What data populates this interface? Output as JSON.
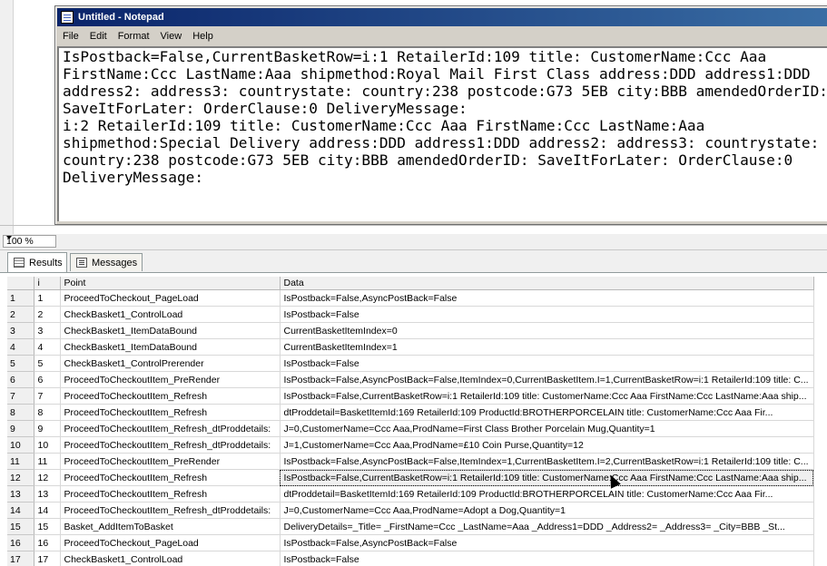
{
  "notepad": {
    "title": "Untitled - Notepad",
    "menu": [
      "File",
      "Edit",
      "Format",
      "View",
      "Help"
    ],
    "text": "IsPostback=False,CurrentBasketRow=i:1 RetailerId:109 title: CustomerName:Ccc Aaa\nFirstName:Ccc LastName:Aaa shipmethod:Royal Mail First Class address:DDD address1:DDD\naddress2: address3: countrystate: country:238 postcode:G73 5EB city:BBB amendedOrderID:\nSaveItForLater: OrderClause:0 DeliveryMessage:\ni:2 RetailerId:109 title: CustomerName:Ccc Aaa FirstName:Ccc LastName:Aaa\nshipmethod:Special Delivery address:DDD address1:DDD address2: address3: countrystate:\ncountry:238 postcode:G73 5EB city:BBB amendedOrderID: SaveItForLater: OrderClause:0\nDeliveryMessage:"
  },
  "zoom": {
    "value": "100 %"
  },
  "tabs": [
    {
      "label": "Results",
      "icon": "grid-icon",
      "active": true
    },
    {
      "label": "Messages",
      "icon": "messages-icon",
      "active": false
    }
  ],
  "grid": {
    "columns": [
      "i",
      "Point",
      "Data"
    ],
    "selected_row": 12,
    "rows": [
      {
        "n": "1",
        "i": "1",
        "point": "ProceedToCheckout_PageLoad",
        "data": "IsPostback=False,AsyncPostBack=False"
      },
      {
        "n": "2",
        "i": "2",
        "point": "CheckBasket1_ControlLoad",
        "data": "IsPostback=False"
      },
      {
        "n": "3",
        "i": "3",
        "point": "CheckBasket1_ItemDataBound",
        "data": "CurrentBasketItemIndex=0"
      },
      {
        "n": "4",
        "i": "4",
        "point": "CheckBasket1_ItemDataBound",
        "data": "CurrentBasketItemIndex=1"
      },
      {
        "n": "5",
        "i": "5",
        "point": "CheckBasket1_ControlPrerender",
        "data": "IsPostback=False"
      },
      {
        "n": "6",
        "i": "6",
        "point": "ProceedToCheckoutItem_PreRender",
        "data": "IsPostback=False,AsyncPostBack=False,ItemIndex=0,CurrentBasketItem.I=1,CurrentBasketRow=i:1 RetailerId:109 title: C..."
      },
      {
        "n": "7",
        "i": "7",
        "point": "ProceedToCheckoutItem_Refresh",
        "data": "IsPostback=False,CurrentBasketRow=i:1 RetailerId:109 title: CustomerName:Ccc Aaa FirstName:Ccc LastName:Aaa ship..."
      },
      {
        "n": "8",
        "i": "8",
        "point": "ProceedToCheckoutItem_Refresh",
        "data": "dtProddetail=BasketItemId:169 RetailerId:109 ProductId:BROTHERPORCELAIN                    title: CustomerName:Ccc Aaa Fir..."
      },
      {
        "n": "9",
        "i": "9",
        "point": "ProceedToCheckoutItem_Refresh_dtProddetails:",
        "data": "J=0,CustomerName=Ccc Aaa,ProdName=First Class Brother Porcelain Mug,Quantity=1"
      },
      {
        "n": "10",
        "i": "10",
        "point": "ProceedToCheckoutItem_Refresh_dtProddetails:",
        "data": "J=1,CustomerName=Ccc Aaa,ProdName=£10 Coin Purse,Quantity=12"
      },
      {
        "n": "11",
        "i": "11",
        "point": "ProceedToCheckoutItem_PreRender",
        "data": "IsPostback=False,AsyncPostBack=False,ItemIndex=1,CurrentBasketItem.I=2,CurrentBasketRow=i:1 RetailerId:109 title: C..."
      },
      {
        "n": "12",
        "i": "12",
        "point": "ProceedToCheckoutItem_Refresh",
        "data": "IsPostback=False,CurrentBasketRow=i:1 RetailerId:109 title: CustomerName:Ccc Aaa FirstName:Ccc LastName:Aaa ship..."
      },
      {
        "n": "13",
        "i": "13",
        "point": "ProceedToCheckoutItem_Refresh",
        "data": "dtProddetail=BasketItemId:169 RetailerId:109 ProductId:BROTHERPORCELAIN                    title: CustomerName:Ccc Aaa Fir..."
      },
      {
        "n": "14",
        "i": "14",
        "point": "ProceedToCheckoutItem_Refresh_dtProddetails:",
        "data": "J=0,CustomerName=Ccc Aaa,ProdName=Adopt a Dog,Quantity=1"
      },
      {
        "n": "15",
        "i": "15",
        "point": "Basket_AddItemToBasket",
        "data": "DeliveryDetails=_Title=  _FirstName=Ccc  _LastName=Aaa  _Address1=DDD  _Address2=  _Address3=  _City=BBB  _St..."
      },
      {
        "n": "16",
        "i": "16",
        "point": "ProceedToCheckout_PageLoad",
        "data": "IsPostback=False,AsyncPostBack=False"
      },
      {
        "n": "17",
        "i": "17",
        "point": "CheckBasket1_ControlLoad",
        "data": "IsPostback=False"
      }
    ]
  }
}
